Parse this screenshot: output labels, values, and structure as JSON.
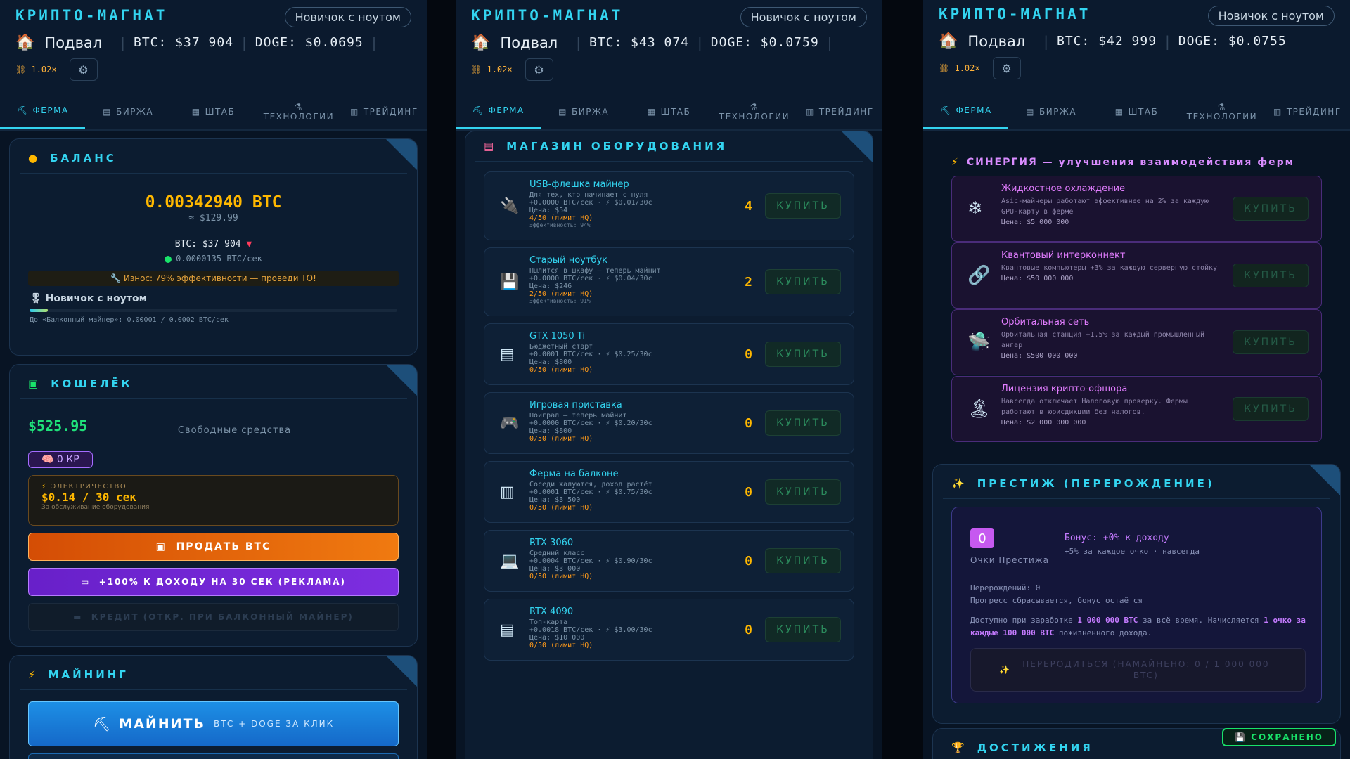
{
  "app": {
    "brand": "КРИПТО-МАГНАТ",
    "rank_button": "Новичок с ноутом",
    "location": "Подвал",
    "multiplier": "1.02×"
  },
  "tabs": [
    {
      "label": "ФЕРМА",
      "icon": "pickaxe-icon"
    },
    {
      "label": "БИРЖА",
      "icon": "exchange-icon"
    },
    {
      "label": "ШТАБ",
      "icon": "hq-icon"
    },
    {
      "label": "ТЕХНОЛОГИИ",
      "icon": "tech-icon"
    },
    {
      "label": "ТРЕЙДИНГ",
      "icon": "chart-icon"
    }
  ],
  "panels": [
    {
      "btc_price": "BTC: $37 904",
      "doge_price": "DOGE: $0.0695"
    },
    {
      "btc_price": "BTC: $43 074",
      "doge_price": "DOGE: $0.0759"
    },
    {
      "btc_price": "BTC: $42 999",
      "doge_price": "DOGE: $0.0755"
    }
  ],
  "balance": {
    "title": "БАЛАНС",
    "btc": "0.00342940 BTC",
    "usd": "≈ $129.99",
    "btc_rate": "BTC: $37 904",
    "per_sec": "0.0000135 BTC/сек",
    "wear": "Износ: 79% эффективности — проведи ТО!",
    "rank": "Новичок с ноутом",
    "progress_fraction": 0.05,
    "progress_text": "До «Балконный майнер»: 0.00001 / 0.0002 BTC/сек"
  },
  "wallet": {
    "title": "КОШЕЛЁК",
    "usd": "$525.95",
    "free_label": "Свободные средства",
    "kp": "0 КР",
    "elec_label": "ЭЛЕКТРИЧЕСТВО",
    "elec_value": "$0.14 / 30 сек",
    "elec_sub": "За обслуживание оборудования",
    "sell_button": "ПРОДАТЬ BTC",
    "ad_button": "+100% К ДОХОДУ НА 30 СЕК (РЕКЛАМА)",
    "credit_button": "КРЕДИТ (ОТКР. ПРИ БАЛКОННЫЙ МАЙНЕР)"
  },
  "mining": {
    "title": "МАЙНИНГ",
    "button_big": "МАЙНИТЬ",
    "button_small": "BTC + DOGE ЗА КЛИК"
  },
  "shop": {
    "title": "МАГАЗИН ОБОРУДОВАНИЯ",
    "buy_label": "КУПИТЬ",
    "items": [
      {
        "name": "USB-флешка майнер",
        "desc": "Для тех, кто начинает с нуля",
        "line": "+0.0000 BTC/сек · ⚡ $0.01/30с",
        "price": "Цена: $54",
        "limit": "4/50 (лимит HQ)",
        "eff": "Эффективность: 94%",
        "count": "4",
        "icon": "usb-icon"
      },
      {
        "name": "Старый ноутбук",
        "desc": "Пылится в шкафу — теперь майнит",
        "line": "+0.0000 BTC/сек · ⚡ $0.04/30с",
        "price": "Цена: $246",
        "limit": "2/50 (лимит HQ)",
        "eff": "Эффективность: 91%",
        "count": "2",
        "icon": "floppy-icon"
      },
      {
        "name": "GTX 1050 Ti",
        "desc": "Бюджетный старт",
        "line": "+0.0001 BTC/сек · ⚡ $0.25/30с",
        "price": "Цена: $800",
        "limit": "0/50 (лимит HQ)",
        "eff": "",
        "count": "0",
        "icon": "gpu-icon"
      },
      {
        "name": "Игровая приставка",
        "desc": "Поиграл — теперь майнит",
        "line": "+0.0000 BTC/сек · ⚡ $0.20/30с",
        "price": "Цена: $800",
        "limit": "0/50 (лимит HQ)",
        "eff": "",
        "count": "0",
        "icon": "gamepad-icon"
      },
      {
        "name": "Ферма на балконе",
        "desc": "Соседи жалуются, доход растёт",
        "line": "+0.0001 BTC/сек · ⚡ $0.75/30с",
        "price": "Цена: $3 500",
        "limit": "0/50 (лимит HQ)",
        "eff": "",
        "count": "0",
        "icon": "balcony-icon"
      },
      {
        "name": "RTX 3060",
        "desc": "Средний класс",
        "line": "+0.0004 BTC/сек · ⚡ $0.90/30с",
        "price": "Цена: $3 000",
        "limit": "0/50 (лимит HQ)",
        "eff": "",
        "count": "0",
        "icon": "laptop-icon"
      },
      {
        "name": "RTX 4090",
        "desc": "Топ-карта",
        "line": "+0.0018 BTC/сек · ⚡ $3.00/30с",
        "price": "Цена: $10 000",
        "limit": "0/50 (лимит HQ)",
        "eff": "",
        "count": "0",
        "icon": "gpu-icon"
      }
    ]
  },
  "synergy": {
    "title": "СИНЕРГИЯ — улучшения взаимодействия ферм",
    "buy_label": "КУПИТЬ",
    "items": [
      {
        "name": "Жидкостное охлаждение",
        "desc": "Asic-майнеры работают эффективнее на 2% за каждую GPU-карту в ферме",
        "price": "Цена: $5 000 000",
        "icon": "snowflake-icon"
      },
      {
        "name": "Квантовый интерконнект",
        "desc": "Квантовые компьютеры +3% за каждую серверную стойку",
        "price": "Цена: $50 000 000",
        "icon": "link-icon"
      },
      {
        "name": "Орбитальная сеть",
        "desc": "Орбитальная станция +1.5% за каждый промышленный ангар",
        "price": "Цена: $500 000 000",
        "icon": "ufo-icon"
      },
      {
        "name": "Лицензия крипто-офшора",
        "desc": "Навсегда отключает Налоговую проверку. Фермы работают в юрисдикции без налогов.",
        "price": "Цена: $2 000 000 000",
        "icon": "island-icon"
      }
    ]
  },
  "prestige": {
    "title": "ПРЕСТИЖ (ПЕРЕРОЖДЕНИЕ)",
    "points": "0",
    "points_label": "Очки Престижа",
    "bonus": "Бонус: +0% к доходу",
    "bonus_sub": "+5% за каждое очко · навсегда",
    "rebirths": "Перерождений: 0",
    "reset_note": "Прогресс сбрасывается, бонус остаётся",
    "avail_1": "Доступно при заработке",
    "avail_2": "1 000 000 BTC",
    "avail_3": "за всё время. Начисляется",
    "avail_4": "1 очко за каждые 100 000 BTC",
    "avail_5": "пожизненного дохода.",
    "button": "ПЕРЕРОДИТЬСЯ (НАМАЙНЕНО: 0 / 1 000 000 BTC)"
  },
  "achievements": {
    "title": "ДОСТИЖЕНИЯ"
  },
  "saved_badge": "СОХРАНЕНО"
}
